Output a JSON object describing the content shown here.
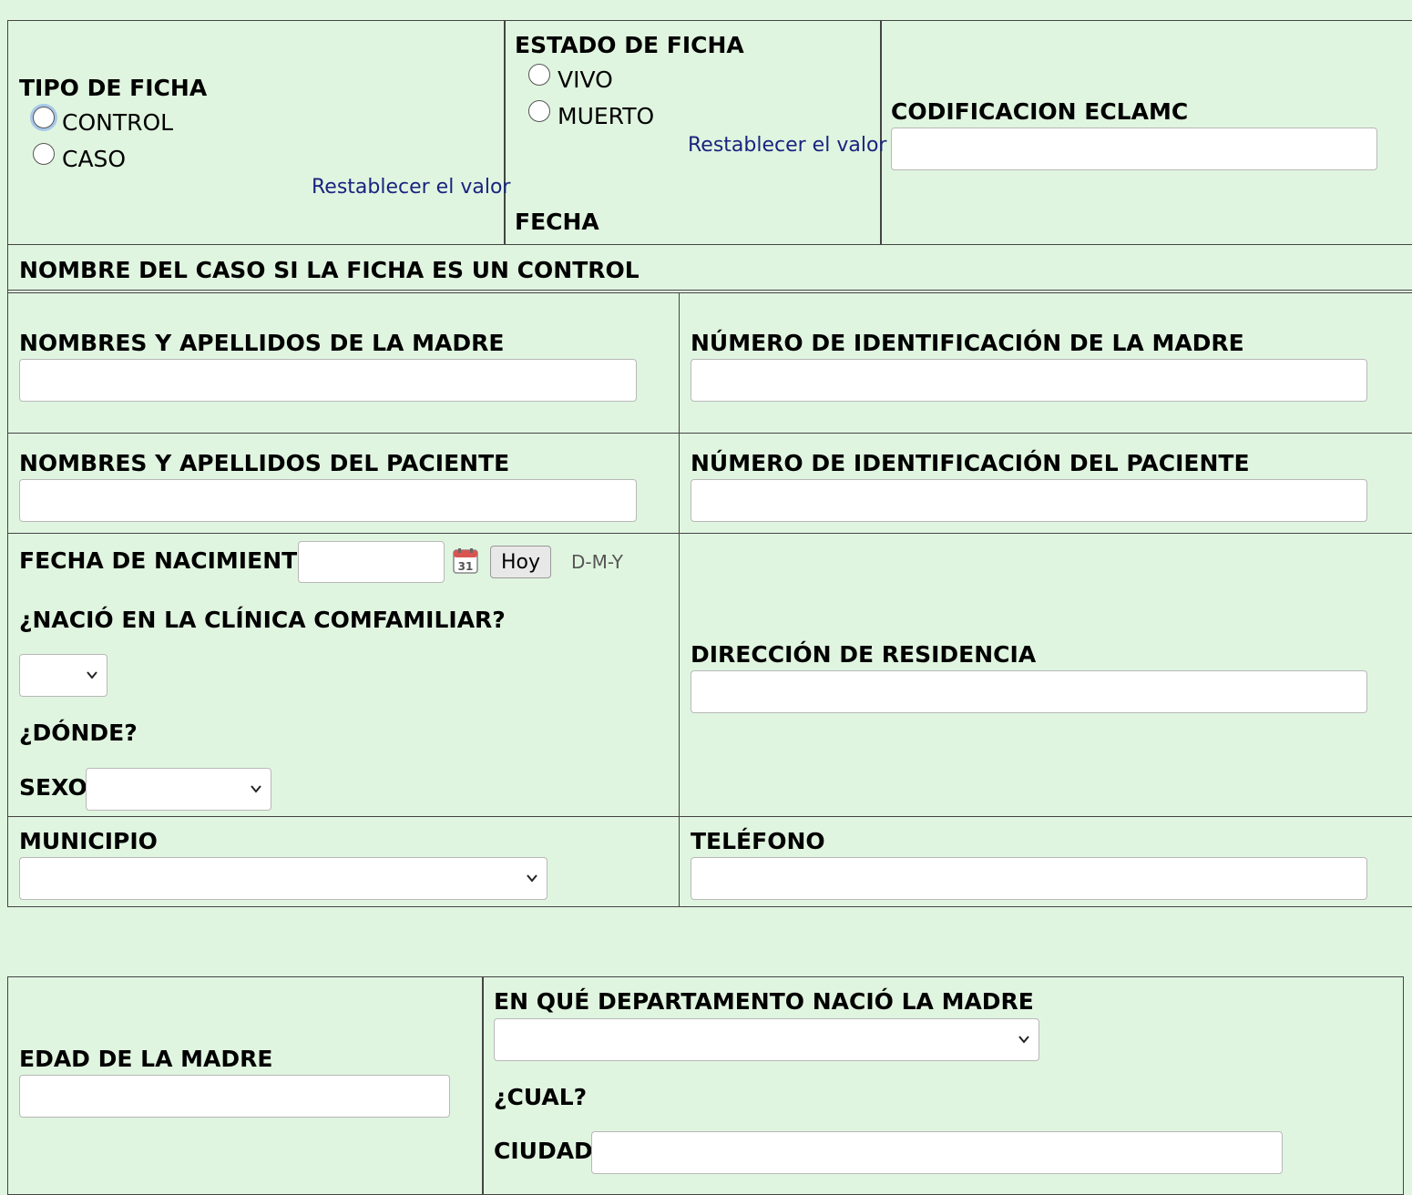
{
  "tipo_ficha": {
    "label": "TIPO DE FICHA",
    "options": [
      "CONTROL",
      "CASO"
    ],
    "reset_link": "Restablecer el valor"
  },
  "estado_ficha": {
    "label": "ESTADO DE FICHA",
    "options": [
      "VIVO",
      "MUERTO"
    ],
    "reset_link": "Restablecer el valor",
    "fecha_label": "FECHA"
  },
  "codificacion": {
    "label": "CODIFICACION ECLAMC"
  },
  "nombre_caso": {
    "label": "NOMBRE DEL CASO SI LA FICHA ES UN CONTROL"
  },
  "madre_nombre": {
    "label": "NOMBRES Y APELLIDOS DE LA MADRE"
  },
  "madre_id": {
    "label": "NÚMERO DE IDENTIFICACIÓN DE LA MADRE"
  },
  "paciente_nombre": {
    "label": "NOMBRES Y APELLIDOS DEL PACIENTE"
  },
  "paciente_id": {
    "label": "NÚMERO DE IDENTIFICACIÓN DEL PACIENTE"
  },
  "nacimiento": {
    "label": "FECHA DE NACIMIENTO",
    "today_button": "Hoy",
    "format_hint": "D-M-Y",
    "calendar_day": "31"
  },
  "clinica": {
    "label": "¿NACIÓ EN LA CLÍNICA COMFAMILIAR?"
  },
  "donde": {
    "label": "¿DÓNDE?"
  },
  "sexo": {
    "label": "SEXO"
  },
  "direccion": {
    "label": "DIRECCIÓN DE RESIDENCIA"
  },
  "municipio": {
    "label": "MUNICIPIO"
  },
  "telefono": {
    "label": "TELÉFONO"
  },
  "edad_madre": {
    "label": "EDAD DE LA MADRE"
  },
  "departamento": {
    "label": "EN QUÉ DEPARTAMENTO NACIÓ LA MADRE"
  },
  "cual": {
    "label": "¿CUAL?"
  },
  "ciudad": {
    "label": "CIUDAD"
  },
  "colors": {
    "background": "#e0f5e0",
    "link": "#1a237e",
    "calendar_red": "#d9534f"
  },
  "icons": [
    "radio",
    "calendar-icon",
    "chevron-down-icon"
  ]
}
